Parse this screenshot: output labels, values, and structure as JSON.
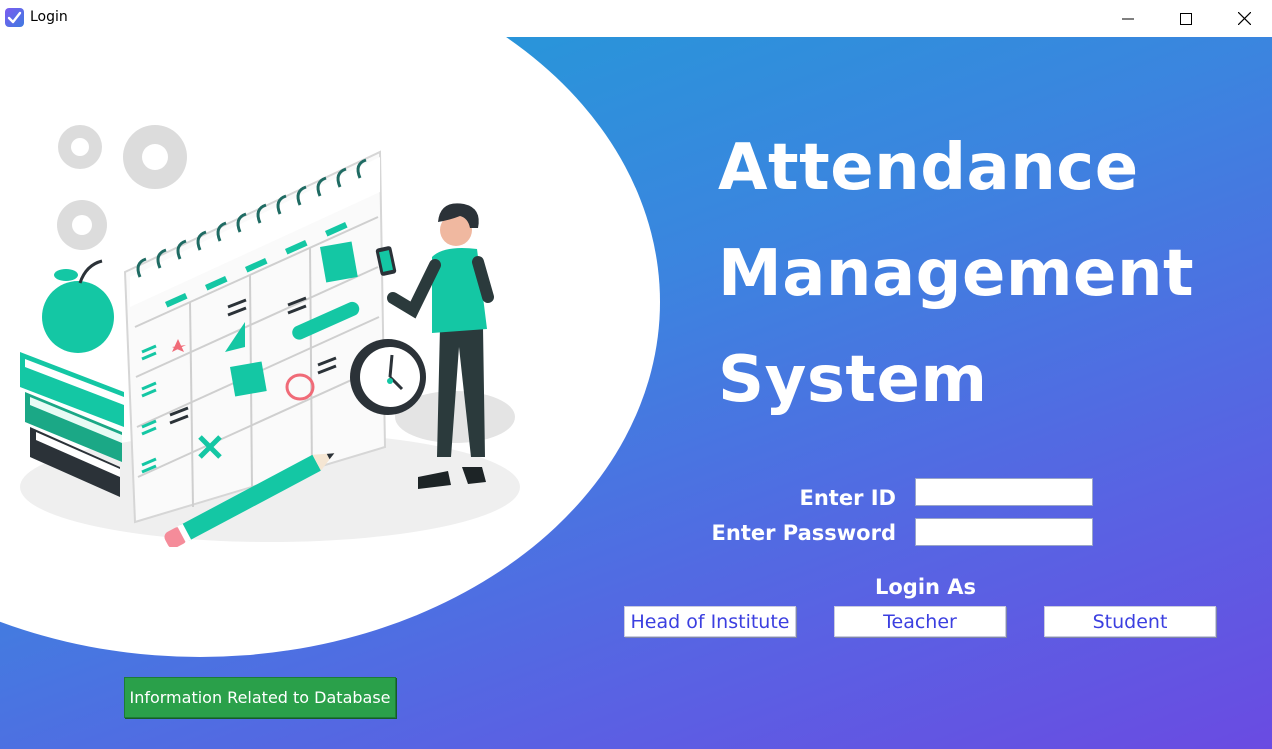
{
  "window": {
    "title": "Login",
    "icon": "checkbox-app-icon",
    "controls": [
      "minimize-icon",
      "maximize-icon",
      "close-icon"
    ]
  },
  "heading": {
    "line1": "Attendance",
    "line2": "Management",
    "line3": "System"
  },
  "form": {
    "id_label": "Enter ID",
    "id_value": "",
    "password_label": "Enter Password",
    "password_value": ""
  },
  "login_as": {
    "label": "Login As",
    "options": [
      "Head of Institute",
      "Teacher",
      "Student"
    ]
  },
  "database_button": "Information Related to Database",
  "colors": {
    "gradient_start": "#1d9fd6",
    "gradient_end": "#6a4be2",
    "accent_teal": "#14c7a4",
    "role_button_text": "#3b3fe0",
    "database_button_bg": "#2aa04a"
  }
}
